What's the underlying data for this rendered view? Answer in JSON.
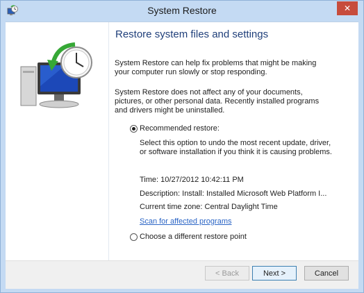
{
  "window": {
    "title": "System Restore",
    "accent": "#c4daf3",
    "close_color": "#c74c3c",
    "close_glyph": "✕"
  },
  "icons": {
    "app": "system-restore-icon",
    "hero": "system-restore-monitor-clock-icon"
  },
  "main": {
    "heading": "Restore system files and settings",
    "para1": "System Restore can help fix problems that might be making your computer run slowly or stop responding.",
    "para2": "System Restore does not affect any of your documents, pictures, or other personal data. Recently installed programs and drivers might be uninstalled.",
    "recommended": {
      "label": "Recommended restore:",
      "checked": true,
      "description": "Select this option to undo the most recent update, driver, or software installation if you think it is causing problems.",
      "time": "Time: 10/27/2012 10:42:11 PM",
      "desc": "Description: Install: Installed Microsoft Web Platform I...",
      "timezone": "Current time zone: Central Daylight Time"
    },
    "scan_link": "Scan for affected programs",
    "different": {
      "label": "Choose a different restore point",
      "checked": false
    }
  },
  "footer": {
    "back": "< Back",
    "next": "Next >",
    "cancel": "Cancel"
  }
}
